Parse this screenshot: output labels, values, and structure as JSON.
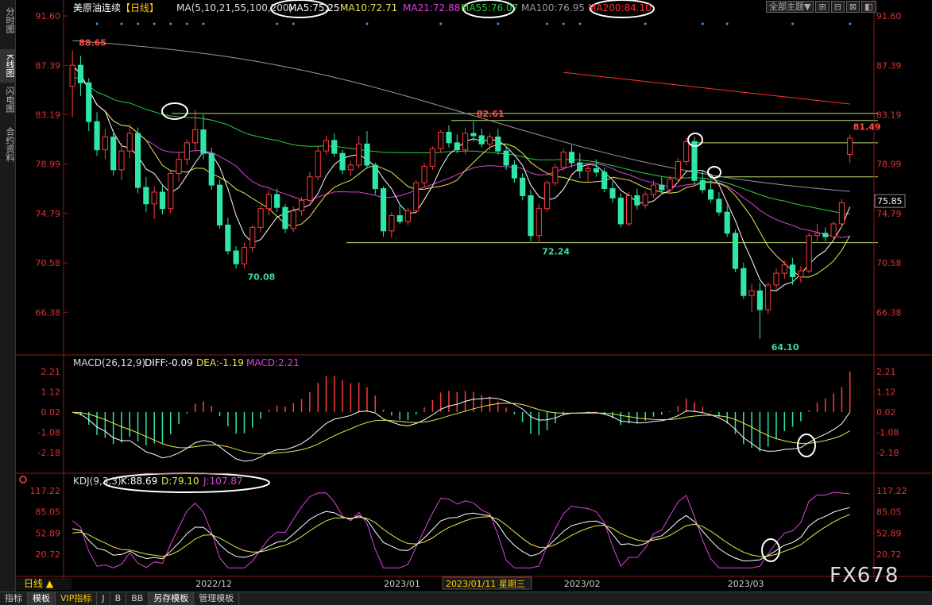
{
  "left_tabs": [
    {
      "label": "分时图",
      "active": false
    },
    {
      "label": "K线图",
      "active": true
    },
    {
      "label": "闪电图",
      "active": false
    },
    {
      "label": "合约资料",
      "active": false
    }
  ],
  "top_buttons": [
    "全部主题▼",
    "⊞",
    "⊟",
    "⊠",
    "◧"
  ],
  "price_panel": {
    "title": "美原油连续",
    "period": "【日线】",
    "ma_label": "MA(5,10,21,55,100,200)",
    "ma_items": [
      {
        "text": "MA5:75.25",
        "color": "#ffffff"
      },
      {
        "text": "MA10:72.71",
        "color": "#e8e84a"
      },
      {
        "text": "MA21:72.88",
        "color": "#e040e0"
      },
      {
        "text": "MA55:76.07",
        "color": "#2ecc40"
      },
      {
        "text": "MA100:76.95",
        "color": "#999999"
      },
      {
        "text": "MA200:84.10",
        "color": "#ff3030"
      }
    ],
    "y_ticks": [
      "91.60",
      "87.39",
      "83.19",
      "78.99",
      "74.79",
      "70.58",
      "66.38"
    ],
    "current_price": "75.85",
    "annotations": [
      "88.65",
      "82.61",
      "81.49",
      "72.24",
      "70.08",
      "64.10"
    ]
  },
  "macd_panel": {
    "label": "MACD(26,12,9)",
    "diff": "DIFF:-0.09",
    "dea": "DEA:-1.19",
    "macd": "MACD:2.21",
    "y_ticks": [
      "2.21",
      "1.12",
      "0.02",
      "-1.08",
      "-2.18"
    ]
  },
  "kdj_panel": {
    "label": "KDJ(9,3,3)",
    "k": "K:88.69",
    "d": "D:79.10",
    "j": "J:107.87",
    "y_ticks": [
      "117.22",
      "85.05",
      "52.89",
      "20.72"
    ]
  },
  "x_axis": {
    "labels": [
      "2022/12",
      "2023/01",
      "2023/01/11 星期三",
      "2023/02",
      "2023/03"
    ]
  },
  "day_label": "日线 ▲",
  "bottom_tabs": [
    "指标",
    "模板",
    "VIP指标",
    "J",
    "B",
    "BB",
    "另存模板",
    "管理模板"
  ],
  "watermark": "FX678",
  "chart_data": [
    {
      "type": "candlestick",
      "title": "美原油连续",
      "ylim": [
        64.1,
        91.6
      ],
      "x_range": [
        "2022/11",
        "2023/03"
      ],
      "ohlc": [
        [
          85.6,
          88.65,
          83.0,
          87.4
        ],
        [
          87.4,
          88.2,
          84.8,
          85.9
        ],
        [
          85.9,
          86.3,
          81.8,
          82.6
        ],
        [
          82.6,
          83.4,
          79.7,
          80.2
        ],
        [
          80.2,
          82.0,
          79.4,
          81.3
        ],
        [
          81.3,
          81.9,
          78.0,
          78.5
        ],
        [
          78.5,
          80.8,
          77.6,
          80.1
        ],
        [
          80.1,
          82.4,
          79.5,
          81.6
        ],
        [
          81.6,
          82.1,
          76.5,
          77.0
        ],
        [
          77.0,
          77.9,
          74.9,
          75.6
        ],
        [
          75.6,
          77.1,
          74.3,
          76.6
        ],
        [
          76.6,
          77.2,
          74.7,
          75.2
        ],
        [
          75.2,
          78.4,
          74.8,
          78.2
        ],
        [
          78.2,
          80.0,
          77.5,
          79.4
        ],
        [
          79.4,
          81.1,
          78.9,
          80.8
        ],
        [
          80.8,
          83.6,
          80.1,
          81.9
        ],
        [
          81.9,
          83.2,
          79.4,
          79.9
        ],
        [
          79.9,
          80.4,
          76.8,
          77.2
        ],
        [
          77.2,
          77.7,
          73.5,
          73.8
        ],
        [
          73.8,
          74.4,
          71.3,
          71.6
        ],
        [
          71.6,
          72.0,
          70.1,
          70.5
        ],
        [
          70.5,
          72.3,
          70.08,
          71.9
        ],
        [
          71.9,
          73.8,
          71.5,
          73.6
        ],
        [
          73.6,
          75.5,
          73.2,
          75.2
        ],
        [
          75.2,
          76.8,
          74.6,
          76.4
        ],
        [
          76.4,
          76.9,
          74.9,
          75.3
        ],
        [
          75.3,
          75.6,
          73.1,
          73.5
        ],
        [
          73.5,
          75.4,
          73.2,
          75.0
        ],
        [
          75.0,
          76.2,
          74.6,
          75.9
        ],
        [
          75.9,
          78.3,
          75.7,
          77.9
        ],
        [
          77.9,
          80.5,
          77.6,
          80.1
        ],
        [
          80.1,
          81.4,
          79.8,
          81.0
        ],
        [
          81.0,
          81.6,
          79.6,
          79.9
        ],
        [
          79.9,
          80.2,
          78.1,
          78.5
        ],
        [
          78.5,
          79.2,
          78.0,
          78.9
        ],
        [
          78.9,
          81.4,
          78.6,
          80.7
        ],
        [
          80.7,
          81.8,
          78.6,
          78.9
        ],
        [
          78.9,
          79.1,
          76.4,
          76.9
        ],
        [
          76.9,
          77.1,
          72.8,
          73.3
        ],
        [
          73.3,
          74.9,
          72.7,
          74.6
        ],
        [
          74.6,
          75.6,
          73.9,
          74.1
        ],
        [
          74.1,
          75.3,
          73.8,
          75.0
        ],
        [
          75.0,
          77.6,
          74.8,
          77.4
        ],
        [
          77.4,
          79.1,
          77.0,
          78.8
        ],
        [
          78.8,
          80.5,
          78.5,
          80.3
        ],
        [
          80.3,
          81.9,
          80.0,
          81.7
        ],
        [
          81.7,
          82.3,
          80.4,
          80.8
        ],
        [
          80.8,
          81.5,
          79.9,
          80.2
        ],
        [
          80.2,
          82.1,
          79.8,
          81.6
        ],
        [
          81.6,
          82.61,
          80.9,
          81.4
        ],
        [
          81.4,
          82.0,
          80.4,
          80.7
        ],
        [
          80.7,
          81.6,
          80.2,
          81.3
        ],
        [
          81.3,
          82.0,
          79.8,
          80.1
        ],
        [
          80.1,
          80.5,
          78.5,
          78.9
        ],
        [
          78.9,
          79.3,
          77.4,
          77.8
        ],
        [
          77.8,
          78.2,
          75.9,
          76.3
        ],
        [
          76.3,
          76.8,
          72.4,
          72.9
        ],
        [
          72.9,
          75.6,
          72.24,
          75.2
        ],
        [
          75.2,
          77.6,
          74.9,
          77.4
        ],
        [
          77.4,
          79.0,
          77.1,
          78.7
        ],
        [
          78.7,
          80.3,
          78.4,
          80.0
        ],
        [
          80.0,
          80.6,
          78.7,
          79.1
        ],
        [
          79.1,
          79.9,
          77.8,
          78.4
        ],
        [
          78.4,
          79.0,
          77.5,
          78.6
        ],
        [
          78.6,
          79.4,
          77.9,
          78.3
        ],
        [
          78.3,
          78.7,
          76.6,
          76.9
        ],
        [
          76.9,
          77.5,
          75.7,
          76.1
        ],
        [
          76.1,
          76.5,
          73.6,
          73.9
        ],
        [
          73.9,
          76.6,
          73.7,
          76.3
        ],
        [
          76.3,
          76.9,
          75.1,
          75.5
        ],
        [
          75.5,
          76.7,
          75.2,
          76.4
        ],
        [
          76.4,
          77.6,
          76.1,
          77.2
        ],
        [
          77.2,
          77.9,
          76.4,
          76.8
        ],
        [
          76.8,
          78.0,
          76.5,
          77.7
        ],
        [
          77.7,
          79.5,
          77.4,
          79.2
        ],
        [
          79.2,
          81.2,
          78.9,
          80.9
        ],
        [
          80.9,
          81.3,
          77.2,
          77.6
        ],
        [
          77.6,
          78.4,
          76.5,
          76.8
        ],
        [
          76.8,
          77.6,
          75.7,
          76.0
        ],
        [
          76.0,
          76.6,
          74.6,
          74.9
        ],
        [
          74.9,
          75.5,
          72.8,
          73.1
        ],
        [
          73.1,
          73.4,
          69.8,
          70.1
        ],
        [
          70.1,
          70.6,
          67.5,
          67.8
        ],
        [
          67.8,
          68.8,
          66.4,
          68.2
        ],
        [
          68.2,
          68.9,
          64.1,
          66.6
        ],
        [
          66.6,
          68.9,
          66.2,
          68.7
        ],
        [
          68.7,
          70.1,
          68.3,
          69.7
        ],
        [
          69.7,
          70.8,
          69.2,
          70.4
        ],
        [
          70.4,
          71.0,
          68.7,
          69.4
        ],
        [
          69.4,
          70.3,
          68.9,
          69.9
        ],
        [
          69.9,
          73.1,
          69.7,
          72.9
        ],
        [
          72.9,
          73.9,
          72.4,
          73.1
        ],
        [
          73.1,
          73.6,
          72.4,
          72.8
        ],
        [
          72.8,
          74.1,
          72.5,
          73.9
        ],
        [
          73.9,
          76.0,
          73.6,
          75.7
        ],
        [
          79.8,
          81.49,
          79.1,
          81.2
        ]
      ],
      "moving_averages": [
        {
          "name": "MA5",
          "last": 75.25
        },
        {
          "name": "MA10",
          "last": 72.71
        },
        {
          "name": "MA21",
          "last": 72.88
        },
        {
          "name": "MA55",
          "last": 76.07
        },
        {
          "name": "MA100",
          "last": 76.95
        },
        {
          "name": "MA200",
          "last": 84.1
        }
      ],
      "horizontal_lines": [
        83.3,
        82.7,
        80.8,
        77.9,
        72.3
      ]
    },
    {
      "type": "macd",
      "ylim": [
        -2.18,
        2.21
      ],
      "diff_last": -0.09,
      "dea_last": -1.19,
      "macd_last": 2.21
    },
    {
      "type": "kdj",
      "ylim": [
        20.72,
        117.22
      ],
      "k_last": 88.69,
      "d_last": 79.1,
      "j_last": 107.87
    }
  ]
}
